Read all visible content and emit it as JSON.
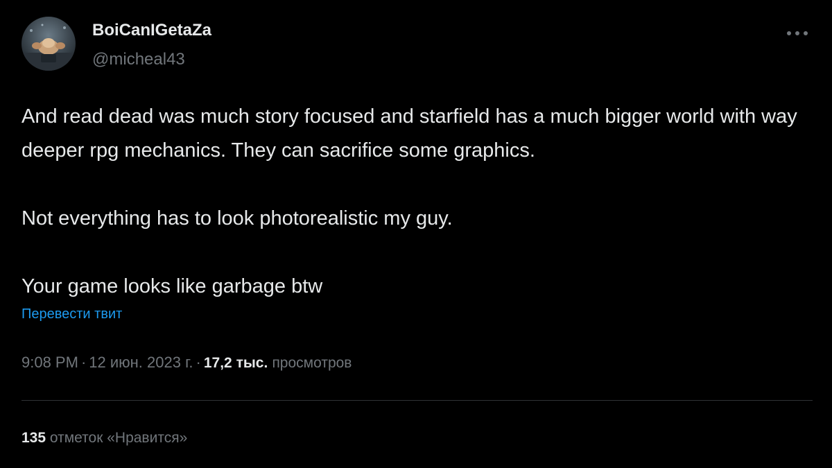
{
  "author": {
    "name": "BoiCanIGetaZa",
    "handle": "@micheal43",
    "avatar_icon": "profile-avatar"
  },
  "menu": {
    "icon": "more-horizontal-icon"
  },
  "tweet": {
    "paragraphs": [
      "And read dead was much story focused and starfield has a much bigger world with way deeper rpg mechanics. They can sacrifice some graphics.",
      "Not everything has to look photorealistic my guy.",
      "Your game looks like garbage btw"
    ],
    "translate_label": "Перевести твит"
  },
  "meta": {
    "time": "9:08 PM",
    "date": "12 июн. 2023 г.",
    "separator": "·",
    "views_count": "17,2 тыс.",
    "views_label": "просмотров"
  },
  "stats": {
    "likes_count": "135",
    "likes_label": "отметок «Нравится»"
  },
  "colors": {
    "background": "#000000",
    "primary_text": "#e7e9ea",
    "secondary_text": "#71767b",
    "link": "#1d9bf0",
    "divider": "#2f3336"
  }
}
